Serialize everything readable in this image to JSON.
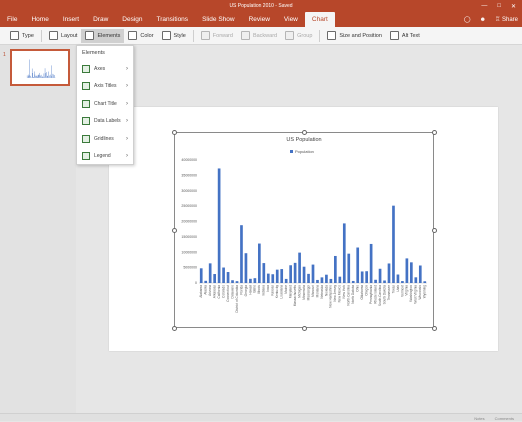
{
  "window": {
    "title": "US Population 2010 - Saved"
  },
  "ribbon": {
    "tabs": [
      "File",
      "Home",
      "Insert",
      "Draw",
      "Design",
      "Transitions",
      "Slide Show",
      "Review",
      "View",
      "Chart"
    ],
    "active_tab": "Chart",
    "share_label": "Share"
  },
  "toolbar": {
    "type": "Type",
    "layout": "Layout",
    "elements": "Elements",
    "color": "Color",
    "style": "Style",
    "forward": "Forward",
    "backward": "Backward",
    "group": "Group",
    "size_position": "Size and Position",
    "alt_text": "Alt Text"
  },
  "slides": {
    "current_number": "1"
  },
  "elements_menu": {
    "title": "Elements",
    "items": [
      {
        "label": "Axes"
      },
      {
        "label": "Axis Titles"
      },
      {
        "label": "Chart Title"
      },
      {
        "label": "Data Labels"
      },
      {
        "label": "Gridlines"
      },
      {
        "label": "Legend"
      }
    ]
  },
  "chart_data": {
    "type": "bar",
    "title": "US Population",
    "legend": [
      "Population"
    ],
    "legend_position": "top",
    "grid": false,
    "ylim": [
      0,
      40000000
    ],
    "y_ticks": [
      "40000000",
      "35000000",
      "30000000",
      "25000000",
      "20000000",
      "15000000",
      "10000000",
      "5000000",
      "0"
    ],
    "categories": [
      "Alabama",
      "Alaska",
      "Arizona",
      "Arkansas",
      "California",
      "Colorado",
      "Connecticut",
      "Delaware",
      "District of Columbia",
      "Florida",
      "Georgia",
      "Hawaii",
      "Idaho",
      "Illinois",
      "Indiana",
      "Iowa",
      "Kansas",
      "Kentucky",
      "Louisiana",
      "Maine",
      "Maryland",
      "Massachusetts",
      "Michigan",
      "Minnesota",
      "Mississippi",
      "Missouri",
      "Montana",
      "Nebraska",
      "Nevada",
      "New Hampshire",
      "New Jersey",
      "New Mexico",
      "New York",
      "North Carolina",
      "North Dakota",
      "Ohio",
      "Oklahoma",
      "Oregon",
      "Pennsylvania",
      "Rhode Island",
      "South Carolina",
      "South Dakota",
      "Tennessee",
      "Texas",
      "Utah",
      "Vermont",
      "Virginia",
      "Washington",
      "West Virginia",
      "Wisconsin",
      "Wyoming"
    ],
    "values": [
      4780000,
      710000,
      6390000,
      2920000,
      37250000,
      5030000,
      3570000,
      900000,
      600000,
      18800000,
      9690000,
      1360000,
      1570000,
      12830000,
      6480000,
      3050000,
      2850000,
      4340000,
      4530000,
      1330000,
      5770000,
      6550000,
      9880000,
      5300000,
      2970000,
      5990000,
      990000,
      1830000,
      2700000,
      1320000,
      8790000,
      2060000,
      19380000,
      9540000,
      670000,
      11540000,
      3750000,
      3830000,
      12700000,
      1050000,
      4630000,
      810000,
      6350000,
      25150000,
      2760000,
      630000,
      8000000,
      6720000,
      1850000,
      5690000,
      560000
    ],
    "series_color": "#4472c4"
  },
  "status": {
    "left_label": "Notes",
    "right_label": "Comments"
  }
}
